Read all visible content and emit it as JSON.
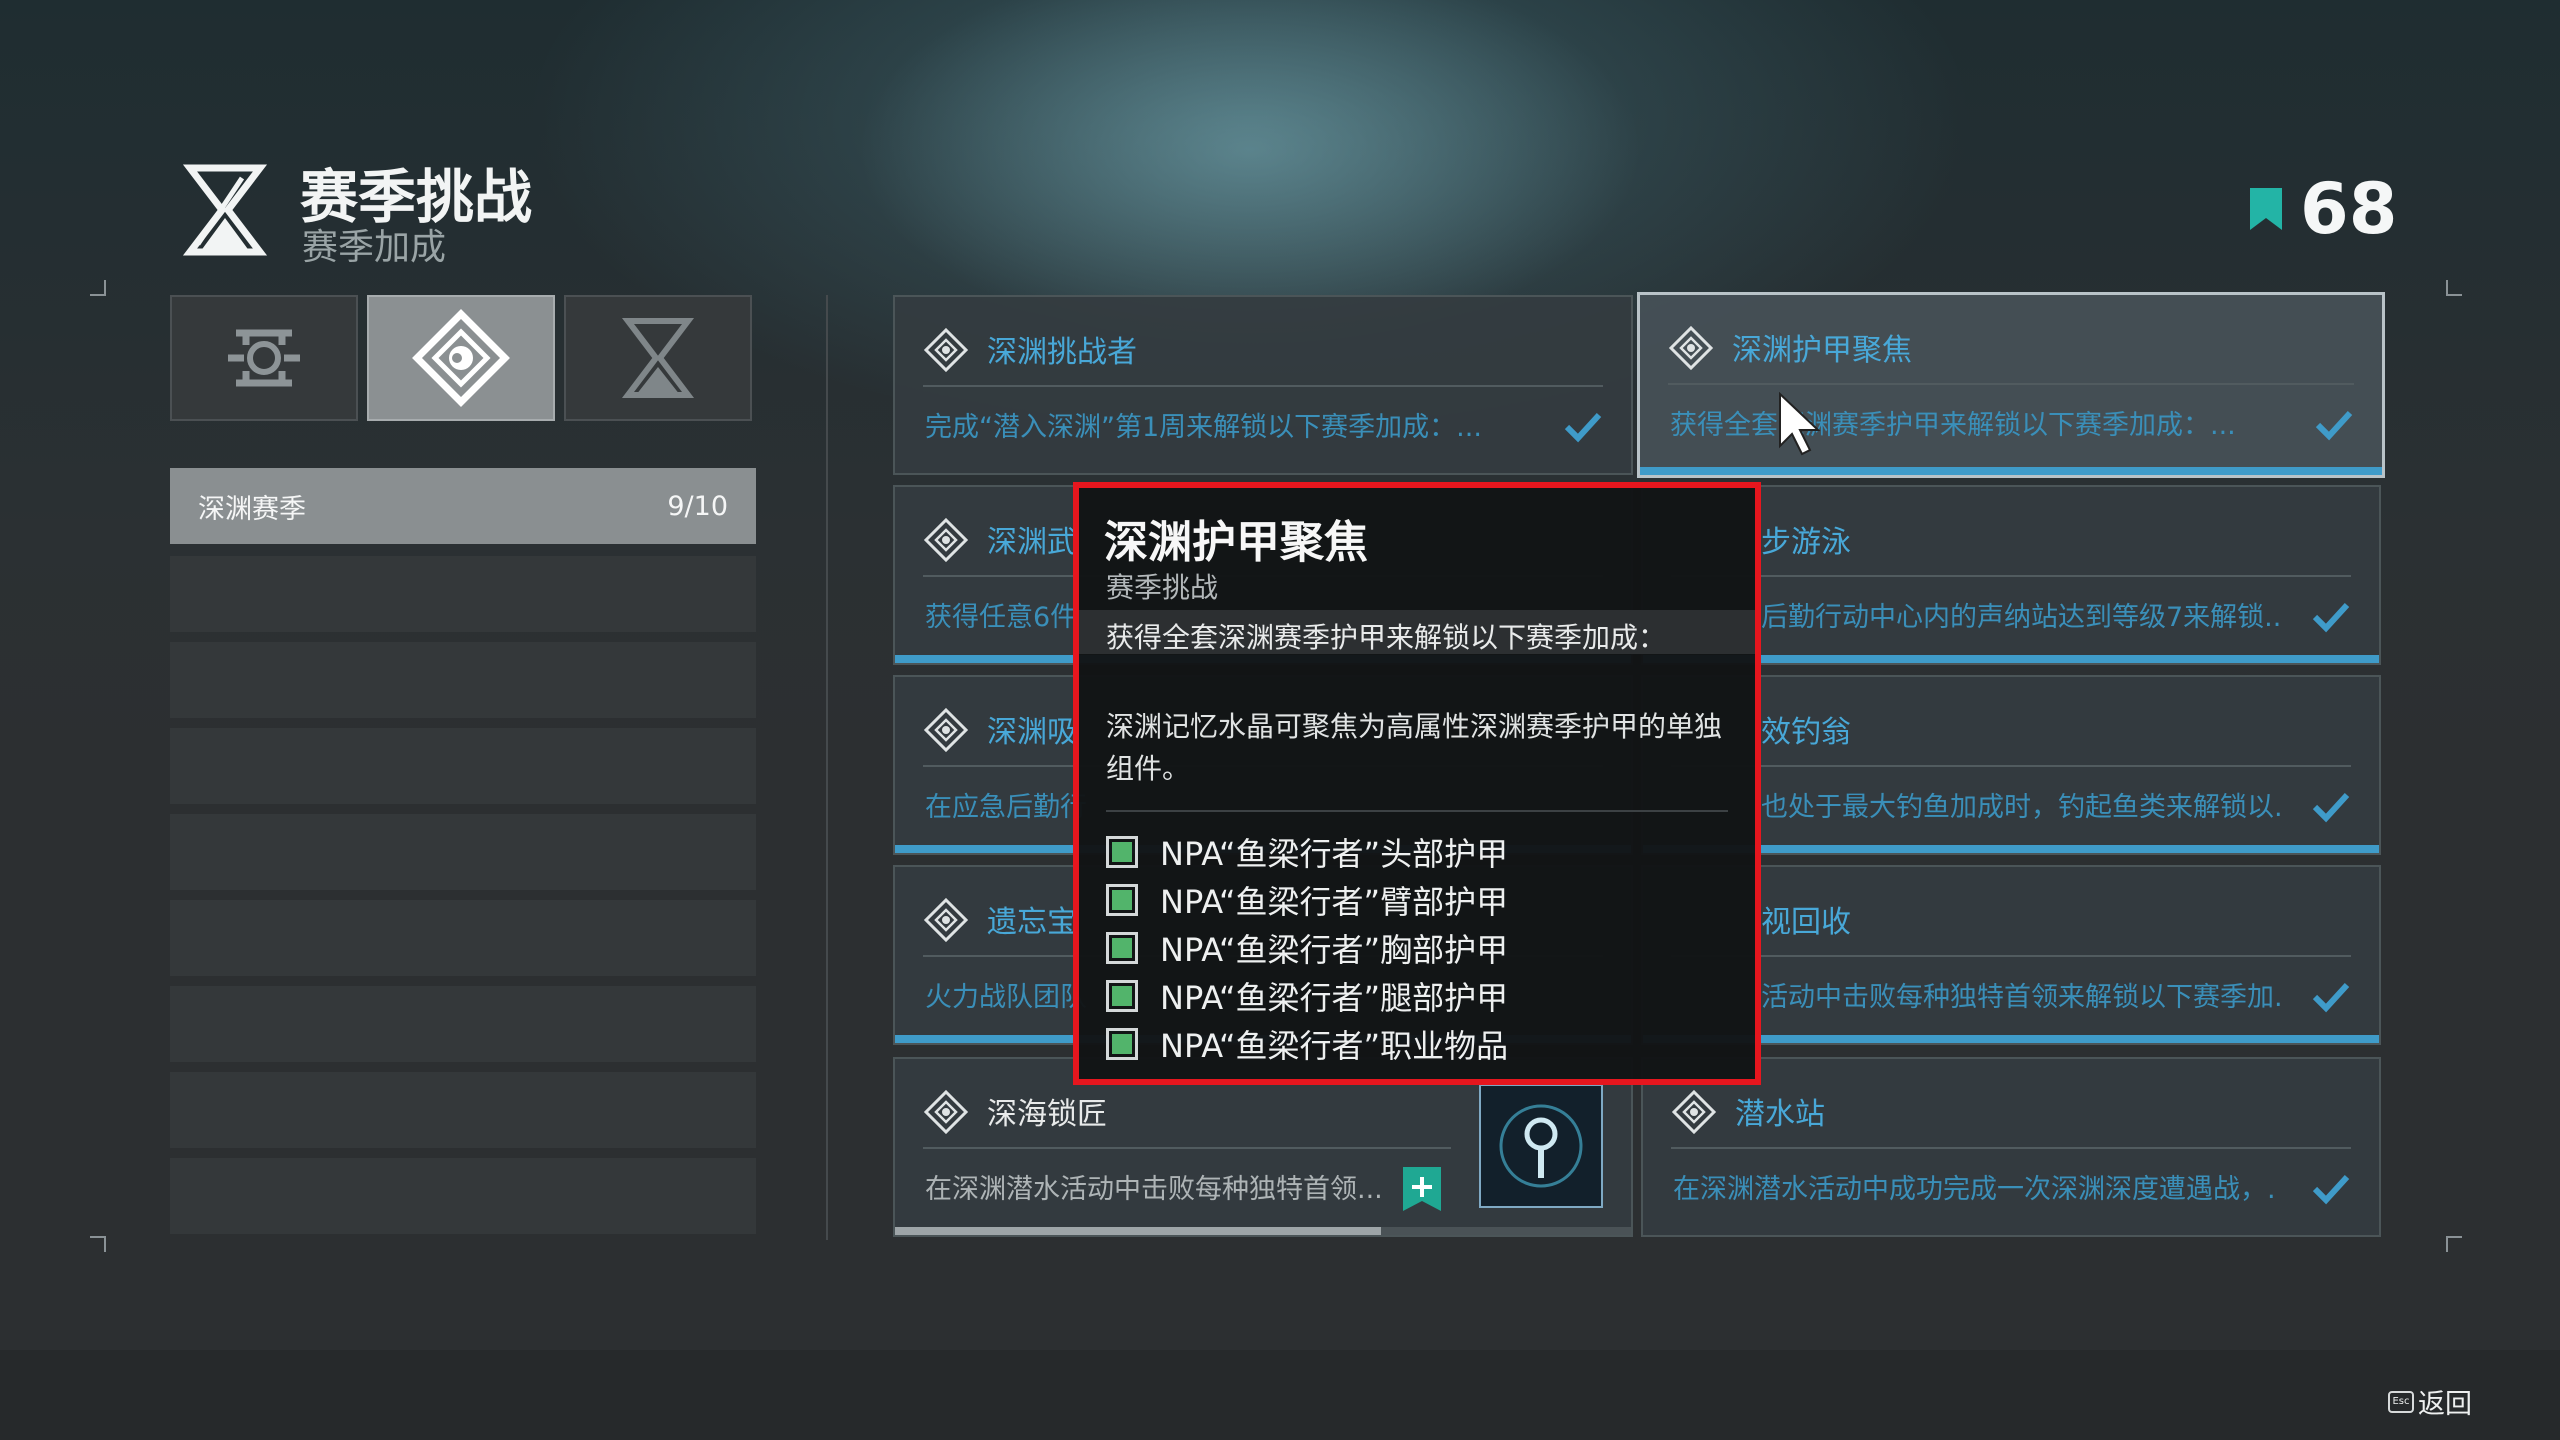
{
  "header": {
    "title": "赛季挑战",
    "subtitle": "赛季加成",
    "rank": "68"
  },
  "category": {
    "label": "深渊赛季",
    "count": "9/10"
  },
  "cards": [
    {
      "title": "深渊挑战者",
      "desc": "完成“潜入深渊”第1周来解锁以下赛季加成：...",
      "icon": "diamond-icon",
      "status": "completed"
    },
    {
      "title": "深渊护甲聚焦",
      "desc": "获得全套深渊赛季护甲来解锁以下赛季加成：...",
      "icon": "diamond-icon",
      "status": "completed"
    },
    {
      "title": "深渊武",
      "desc": "获得任意6件",
      "icon": "diamond-icon",
      "status": "completed"
    },
    {
      "title": "步游泳",
      "desc": "后勤行动中心内的声纳站达到等级7来解锁...",
      "icon": "diamond-icon",
      "status": "completed"
    },
    {
      "title": "深渊吸",
      "desc": "在应急后勤行",
      "icon": "diamond-icon",
      "status": "completed"
    },
    {
      "title": "效钓翁",
      "desc": "也处于最大钓鱼加成时，钓起鱼类来解锁以...",
      "icon": "diamond-icon",
      "status": "completed"
    },
    {
      "title": "遗忘宝",
      "desc": "火力战队团队",
      "icon": "diamond-icon",
      "status": "completed"
    },
    {
      "title": "视回收",
      "desc": "活动中击败每种独特首领来解锁以下赛季加...",
      "icon": "diamond-icon",
      "status": "completed"
    },
    {
      "title": "深海锁匠",
      "desc": "在深渊潜水活动中击败每种独特首领...",
      "icon": "diamond-icon",
      "status": "in-progress",
      "progress": 0.66
    },
    {
      "title": "潜水站",
      "desc": "在深渊潜水活动中成功完成一次深渊深度遭遇战，...",
      "icon": "diamond-icon",
      "status": "completed"
    }
  ],
  "tooltip": {
    "title": "深渊护甲聚焦",
    "subtitle": "赛季挑战",
    "objective": "获得全套深渊赛季护甲来解锁以下赛季加成：",
    "description": "深渊记忆水晶可聚焦为高属性深渊赛季护甲的单独组件。",
    "items": [
      "NPA“鱼梁行者”头部护甲",
      "NPA“鱼梁行者”臂部护甲",
      "NPA“鱼梁行者”胸部护甲",
      "NPA“鱼梁行者”腿部护甲",
      "NPA“鱼梁行者”职业物品"
    ]
  },
  "footer": {
    "back_label": "返回",
    "back_key": "Esc"
  },
  "colors": {
    "accent": "#3f9bc9",
    "highlight": "#e6161e",
    "check": "#52b46b"
  }
}
